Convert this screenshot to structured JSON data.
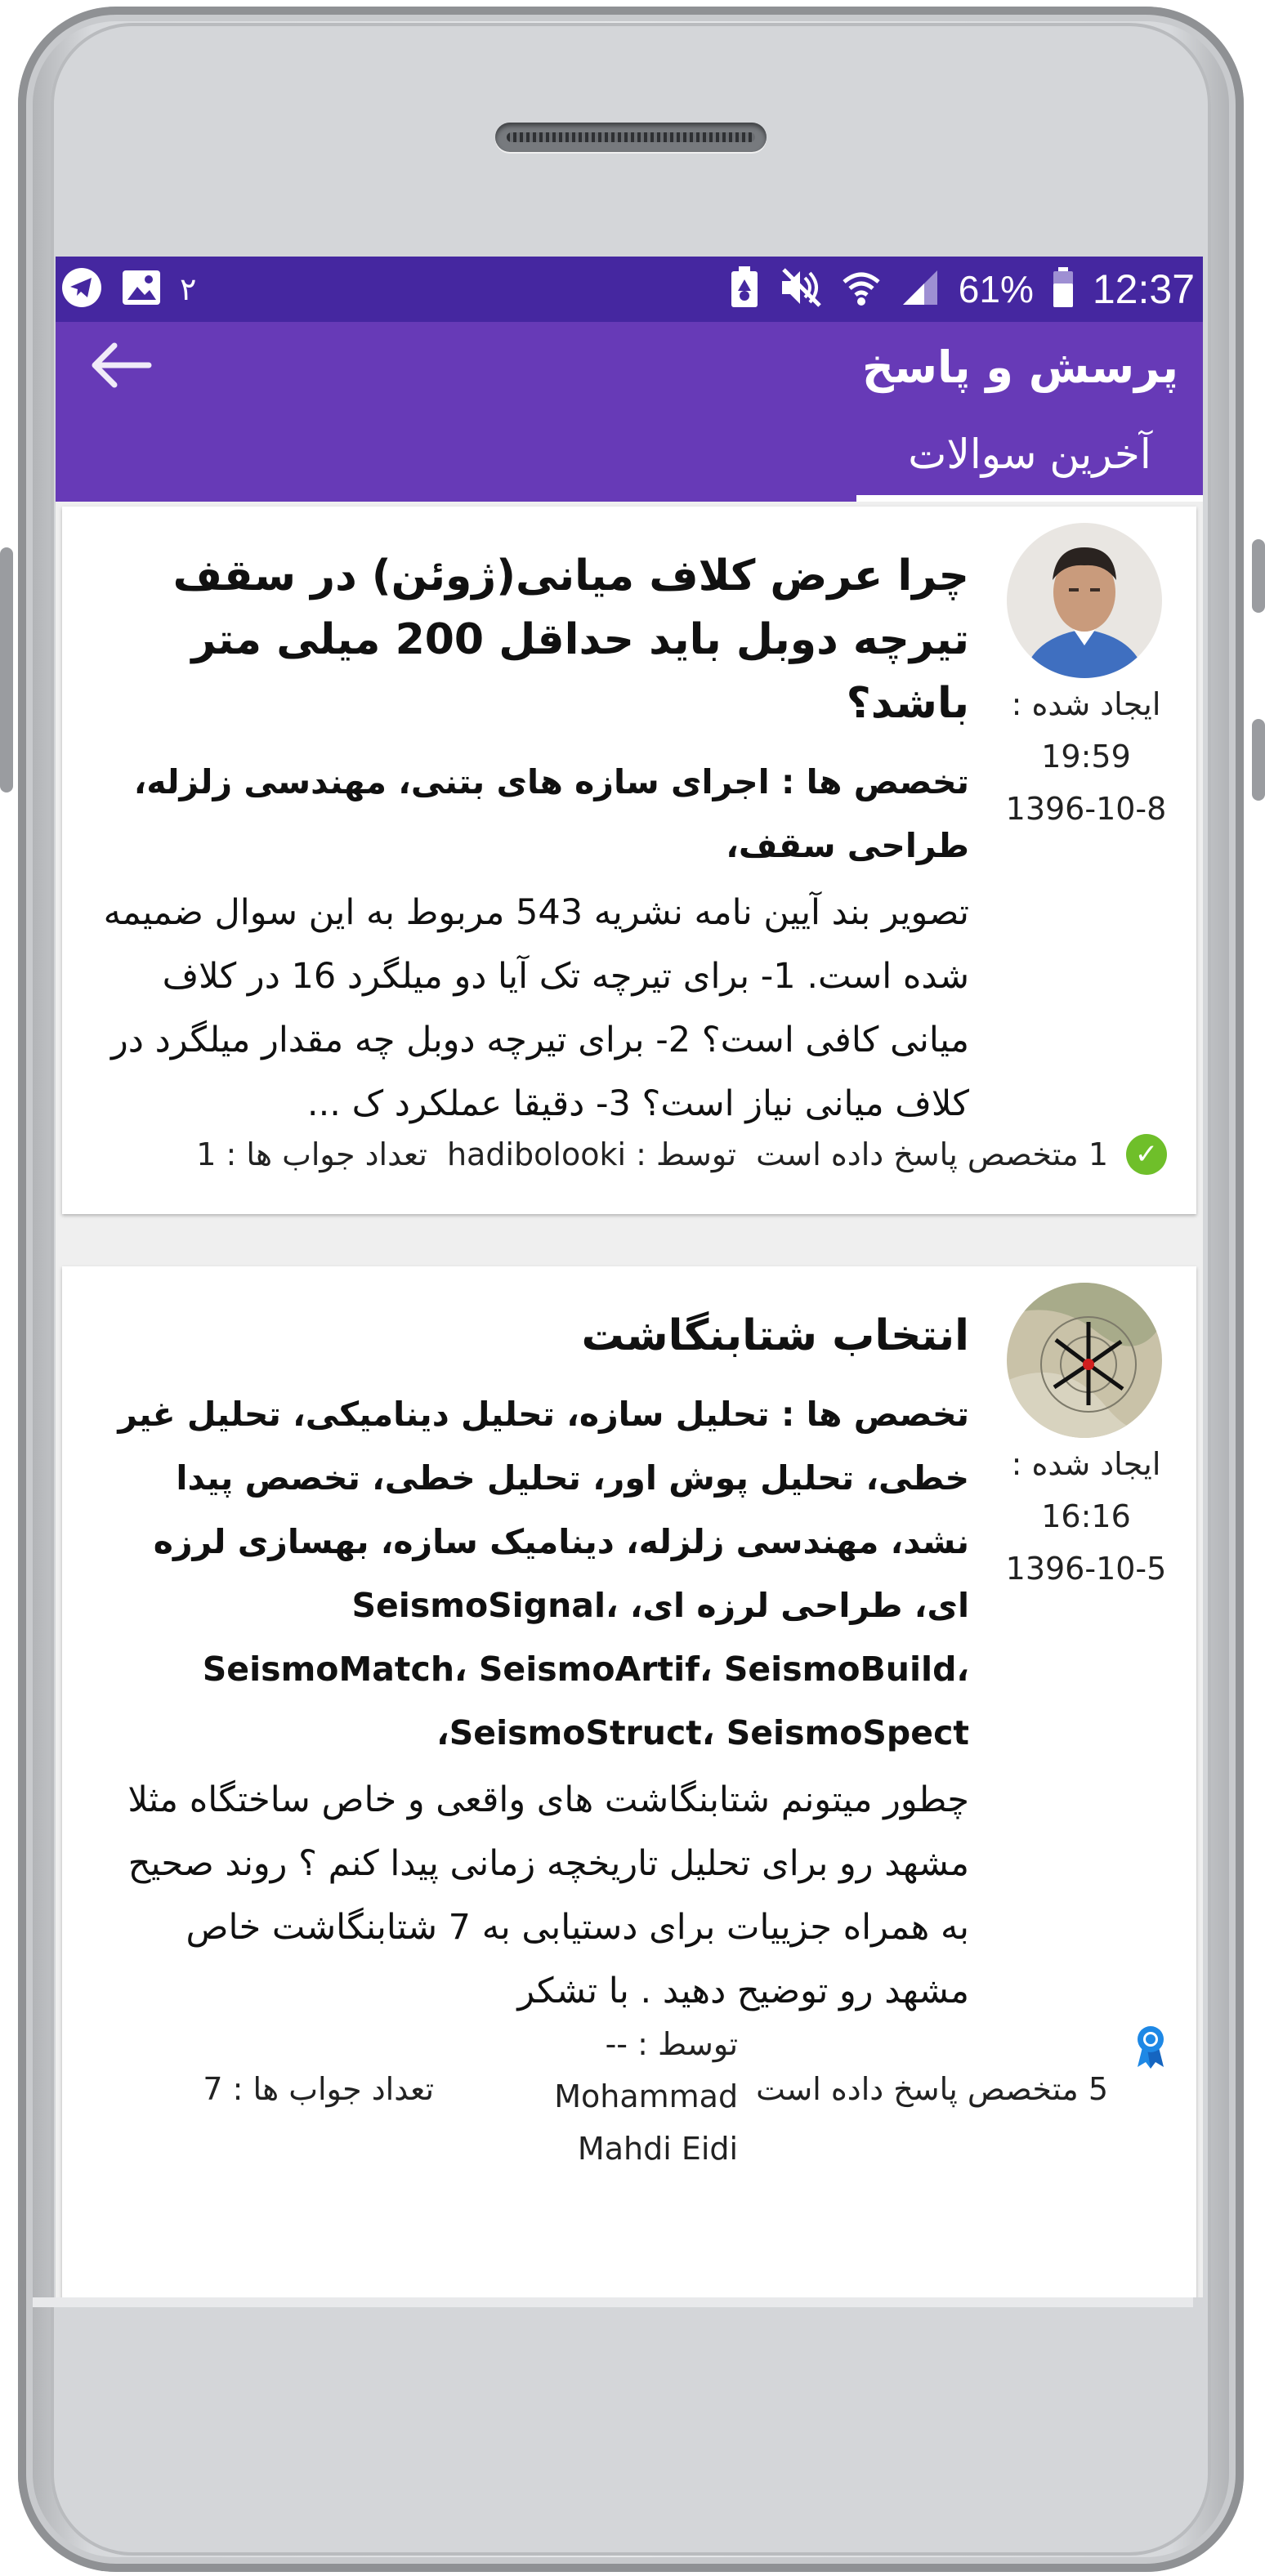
{
  "status_bar": {
    "time": "12:37",
    "battery_percent": "61%",
    "notification_count": "۲",
    "icons": [
      "battery-icon",
      "signal-icon",
      "wifi-icon",
      "mute-icon",
      "recycle-icon",
      "image-icon",
      "telegram-icon"
    ]
  },
  "app_bar": {
    "title": "پرسش و پاسخ",
    "back_icon": "arrow-back-icon"
  },
  "tabs": [
    {
      "label": "آخرین سوالات",
      "selected": true
    }
  ],
  "colors": {
    "status_bar": "#4527a0",
    "app_bar": "#673ab7",
    "check_badge": "#6fbf2a",
    "award_icon": "#1e88e5"
  },
  "questions": [
    {
      "title": "چرا عرض کلاف میانی(ژوئن) در سقف تیرچه دوبل باید حداقل 200 میلی متر باشد؟",
      "expertise": "تخصص ها : اجرای سازه های بتنی، مهندسی زلزله، طراحی سقف،",
      "body": "تصویر بند آیین نامه نشریه 543 مربوط به این سوال ضمیمه شده است. 1- برای تیرچه تک آیا دو میلگرد 16 در کلاف میانی کافی است؟ 2- برای تیرچه دوبل چه مقدار میلگرد در کلاف میانی نیاز است؟ 3- دقیقا عملکرد ک ...",
      "created_label": "ایجاد شده :",
      "created_time": "19:59",
      "created_date": "1396-10-8",
      "answered_by": "1 متخصص پاسخ داده است",
      "author_label": "توسط : hadibolooki",
      "answer_count": "تعداد جواب ها : 1",
      "badge_icon": "check-circle-icon"
    },
    {
      "title": "انتخاب شتابنگاشت",
      "expertise": "تخصص ها : تحلیل سازه، تحلیل دینامیکی، تحلیل غیر خطی، تحلیل پوش اور، تحلیل خطی، تخصص پیدا نشد، مهندسی زلزله، دینامیک سازه، بهسازی لرزه ای، طراحی لرزه ای، SeismoSignal، SeismoMatch، SeismoArtif، SeismoBuild، SeismoStruct، SeismoSpect،",
      "body": "چطور میتونم شتابنگاشت های واقعی و خاص ساختگاه مثلا مشهد رو برای تحلیل تاریخچه زمانی پیدا کنم ؟ روند صحیح به همراه جزییات برای دستیابی به 7 شتابنگاشت خاص مشهد رو توضیح دهید . با تشکر",
      "created_label": "ایجاد شده :",
      "created_time": "16:16",
      "created_date": "1396-10-5",
      "answered_by": "5 متخصص پاسخ داده است",
      "author_label": "توسط : --Mohammad Mahdi Eidi",
      "answer_count": "تعداد جواب ها : 7",
      "badge_icon": "award-ribbon-icon"
    }
  ]
}
